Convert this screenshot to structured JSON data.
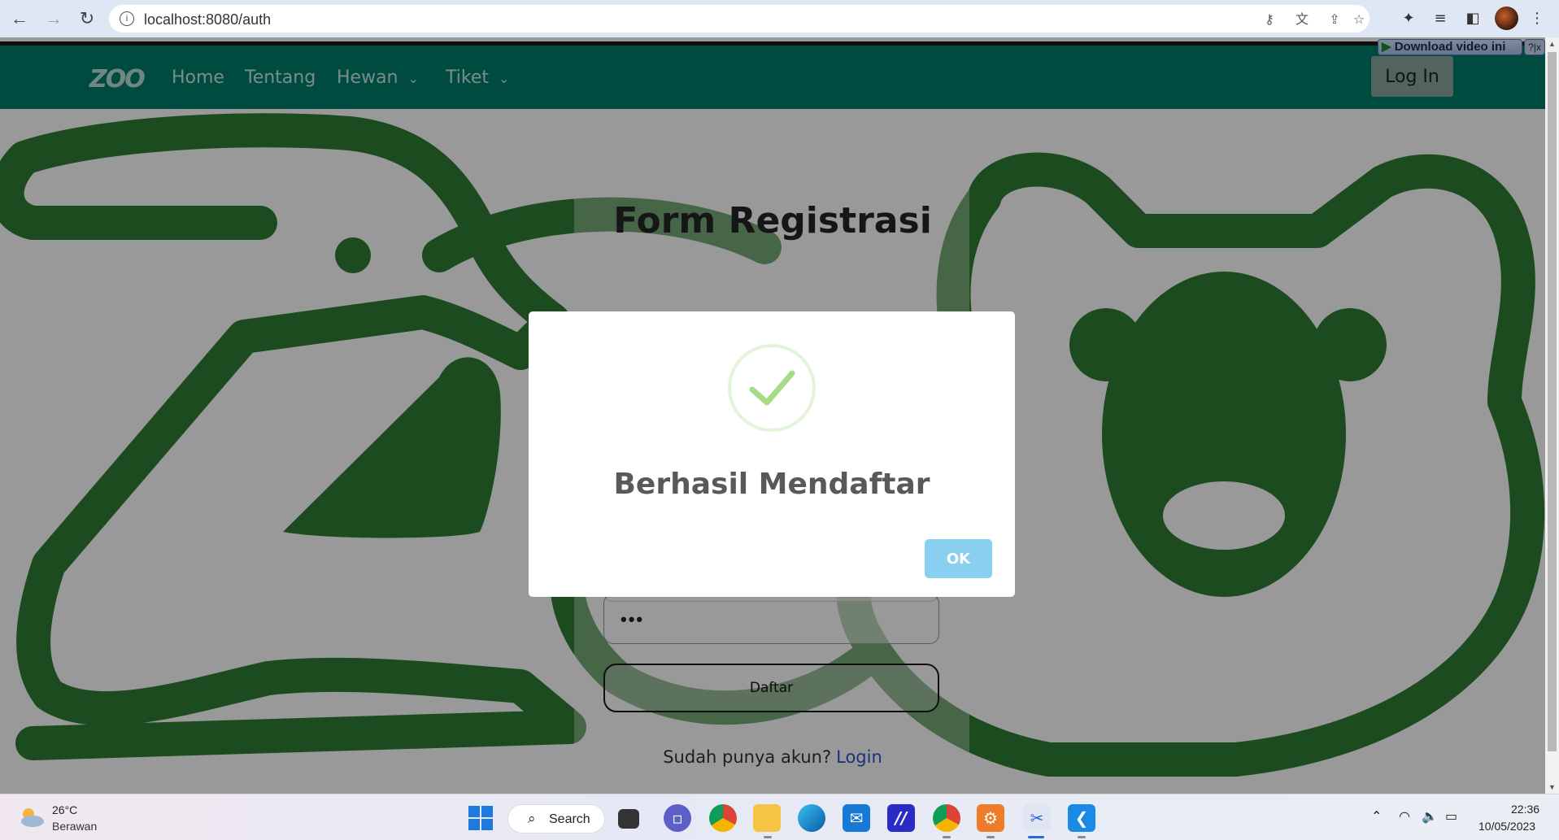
{
  "browser": {
    "url": "localhost:8080/auth",
    "info_icon": "i"
  },
  "navbar": {
    "logo": "ZOO",
    "links": [
      {
        "label": "Home"
      },
      {
        "label": "Tentang"
      },
      {
        "label": "Hewan"
      },
      {
        "label": "Tiket"
      }
    ],
    "login_button": "Log In"
  },
  "extension": {
    "download_video": "Download video ini",
    "close": "?|x"
  },
  "form": {
    "title": "Form Registrasi",
    "password_value": "•••",
    "submit_label": "Daftar",
    "has_account_text": "Sudah punya akun?",
    "login_link": "Login"
  },
  "modal": {
    "title": "Berhasil Mendaftar",
    "ok_label": "OK",
    "colors": {
      "check": "#a5dc86",
      "ok_button": "#89d0f0"
    }
  },
  "taskbar": {
    "weather_temp": "26°C",
    "weather_desc": "Berawan",
    "search_label": "Search",
    "clock_time": "22:36",
    "clock_date": "10/05/2023"
  },
  "colors": {
    "navbar": "#007d6a",
    "art_green": "#2e7d32"
  }
}
